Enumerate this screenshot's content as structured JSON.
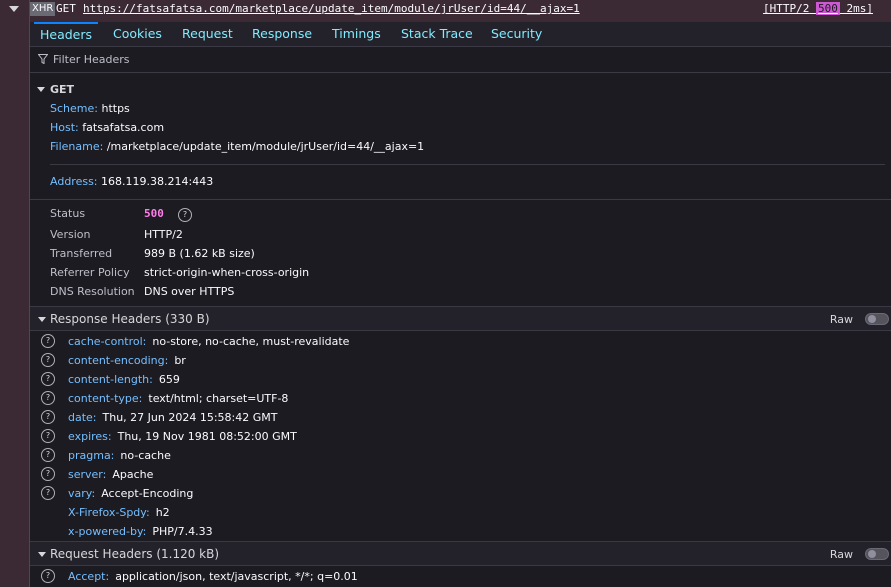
{
  "request": {
    "type_badge": "XHR",
    "method": "GET",
    "url": "https://fatsafatsa.com/marketplace/update_item/module/jrUser/id=44/__ajax=1",
    "right_prefix": "[HTTP/2",
    "right_code": "500",
    "right_suffix": "2ms]"
  },
  "tabs": [
    "Headers",
    "Cookies",
    "Request",
    "Response",
    "Timings",
    "Stack Trace",
    "Security"
  ],
  "filter": {
    "placeholder": "Filter Headers"
  },
  "get_section": {
    "title": "GET",
    "scheme_label": "Scheme:",
    "scheme_value": "https",
    "host_label": "Host:",
    "host_value": "fatsafatsa.com",
    "filename_label": "Filename:",
    "filename_value": "/marketplace/update_item/module/jrUser/id=44/__ajax=1",
    "address_label": "Address:",
    "address_value": "168.119.38.214:443"
  },
  "summary": {
    "status_label": "Status",
    "status_value": "500",
    "version_label": "Version",
    "version_value": "HTTP/2",
    "transferred_label": "Transferred",
    "transferred_value": "989 B (1.62 kB size)",
    "referrer_label": "Referrer Policy",
    "referrer_value": "strict-origin-when-cross-origin",
    "dns_label": "DNS Resolution",
    "dns_value": "DNS over HTTPS"
  },
  "response_headers": {
    "title": "Response Headers (330 B)",
    "raw_label": "Raw",
    "items": [
      {
        "name": "cache-control:",
        "value": "no-store, no-cache, must-revalidate"
      },
      {
        "name": "content-encoding:",
        "value": "br"
      },
      {
        "name": "content-length:",
        "value": "659"
      },
      {
        "name": "content-type:",
        "value": "text/html; charset=UTF-8"
      },
      {
        "name": "date:",
        "value": "Thu, 27 Jun 2024 15:58:42 GMT"
      },
      {
        "name": "expires:",
        "value": "Thu, 19 Nov 1981 08:52:00 GMT"
      },
      {
        "name": "pragma:",
        "value": "no-cache"
      },
      {
        "name": "server:",
        "value": "Apache"
      },
      {
        "name": "vary:",
        "value": "Accept-Encoding"
      },
      {
        "name": "X-Firefox-Spdy:",
        "value": "h2"
      },
      {
        "name": "x-powered-by:",
        "value": "PHP/7.4.33"
      }
    ]
  },
  "request_headers": {
    "title": "Request Headers (1.120 kB)",
    "raw_label": "Raw",
    "items": [
      {
        "name": "Accept:",
        "value": "application/json, text/javascript, */*; q=0.01"
      }
    ]
  },
  "colors": {
    "accent": "#0a84ff",
    "key": "#75bfff",
    "status": "#ff7de9",
    "background": "#1c1b22"
  }
}
